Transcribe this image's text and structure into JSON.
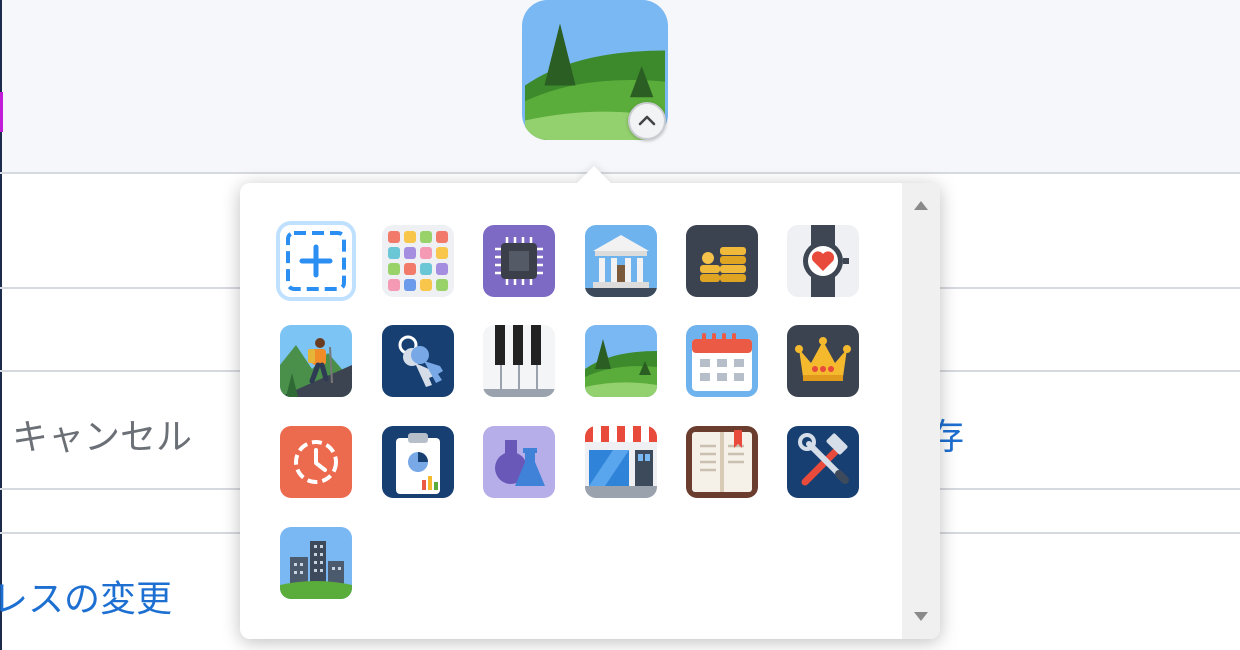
{
  "background": {
    "cancel_label": "キャンセル",
    "save_label_partial": "存",
    "address_change_partial": "レスの変更"
  },
  "avatar": {
    "current_icon": "landscape-icon"
  },
  "icon_picker": {
    "icons": [
      "add-custom-icon",
      "color-grid-icon",
      "chip-icon",
      "bank-icon",
      "coins-icon",
      "heart-watch-icon",
      "hiker-icon",
      "keys-icon",
      "piano-icon",
      "landscape-icon",
      "calendar-icon",
      "crown-icon",
      "history-icon",
      "report-clipboard-icon",
      "flasks-icon",
      "storefront-icon",
      "book-icon",
      "tools-icon",
      "city-icon"
    ],
    "selected_index": 0
  },
  "colors": {
    "link": "#1d6fd1",
    "selection_ring": "#bfe0ff"
  }
}
